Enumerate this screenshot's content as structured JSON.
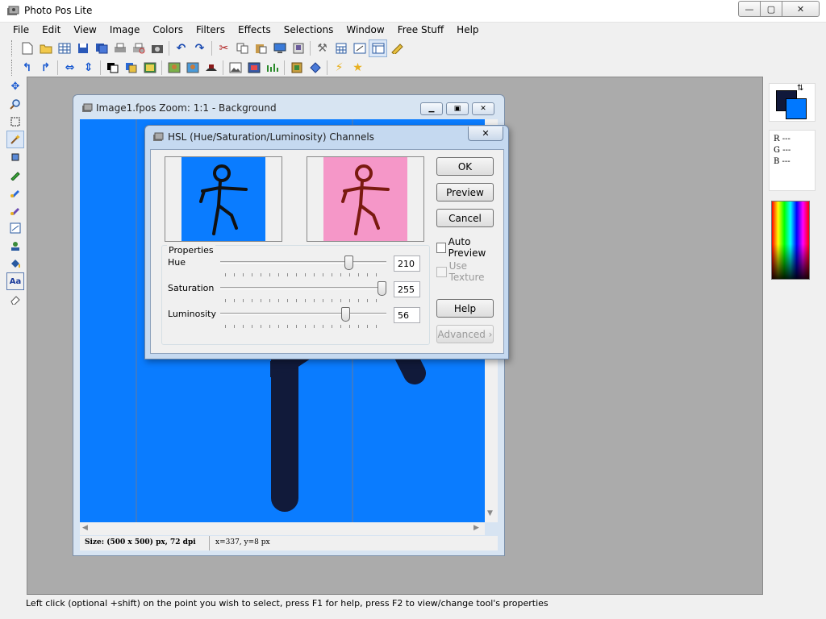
{
  "app": {
    "title": "Photo Pos Lite"
  },
  "window_controls": {
    "minimize": "—",
    "maximize": "▢",
    "close": "✕"
  },
  "menu": [
    "File",
    "Edit",
    "View",
    "Image",
    "Colors",
    "Filters",
    "Effects",
    "Selections",
    "Window",
    "Free Stuff",
    "Help"
  ],
  "toolbar1_icons": [
    "new-file-icon",
    "open-folder-icon",
    "grid-table-icon",
    "save-icon",
    "save-as-icon",
    "print-icon",
    "print-preview-icon",
    "camera-icon",
    "undo-icon",
    "redo-icon",
    "cut-icon",
    "copy-icon",
    "paste-icon",
    "screen-capture-icon",
    "scanner-icon",
    "tools-settings-icon",
    "calculator-icon",
    "resize-icon",
    "table-view-icon",
    "ruler-icon"
  ],
  "toolbar2_icons": [
    "rotate-left-icon",
    "rotate-right-icon",
    "flip-horizontal-icon",
    "flip-vertical-icon",
    "layer-icon",
    "layer-stack-icon",
    "image-adjust-icon",
    "people-add-icon",
    "people-icon",
    "wizard-hat-icon",
    "picture-icon",
    "picture-frame-icon",
    "levels-icon",
    "frame-icon",
    "diamond-icon",
    "lightning-icon",
    "star-icon"
  ],
  "tools": [
    "move-icon",
    "zoom-icon",
    "rect-select-icon",
    "magic-wand-icon",
    "crop-icon",
    "pencil-icon",
    "brush-icon",
    "airbrush-icon",
    "clone-icon",
    "stamp-icon",
    "fill-bucket-icon",
    "text-icon",
    "eraser-icon"
  ],
  "colors": {
    "foreground": "#10183a",
    "background": "#0078ff",
    "canvas": "#0a7cff",
    "figure": "#111a3a",
    "preview_result_bg": "#f597c8",
    "preview_result_figure": "#7a1a10"
  },
  "color_info": {
    "r": "R ---",
    "g": "G ---",
    "b": "B ---"
  },
  "document": {
    "title": "Image1.fpos  Zoom: 1:1 - Background",
    "size_text": "Size: (500 x 500) px, 72 dpi",
    "coords_text": "x=337, y=8 px"
  },
  "dialog": {
    "title": "HSL (Hue/Saturation/Luminosity) Channels",
    "close": "✕",
    "buttons": {
      "ok": "OK",
      "preview": "Preview",
      "cancel": "Cancel",
      "help": "Help",
      "advanced": "Advanced ›"
    },
    "checkboxes": {
      "auto_preview": "Auto Preview",
      "use_texture": "Use Texture"
    },
    "properties_label": "Properties",
    "hue": {
      "label": "Hue",
      "value": "210",
      "fraction": 0.79
    },
    "saturation": {
      "label": "Saturation",
      "value": "255",
      "fraction": 1.0
    },
    "luminosity": {
      "label": "Luminosity",
      "value": "56",
      "fraction": 0.77
    }
  },
  "status": {
    "message": "Left click (optional +shift) on the point you wish to select, press F1 for help, press F2 to view/change tool's properties"
  }
}
